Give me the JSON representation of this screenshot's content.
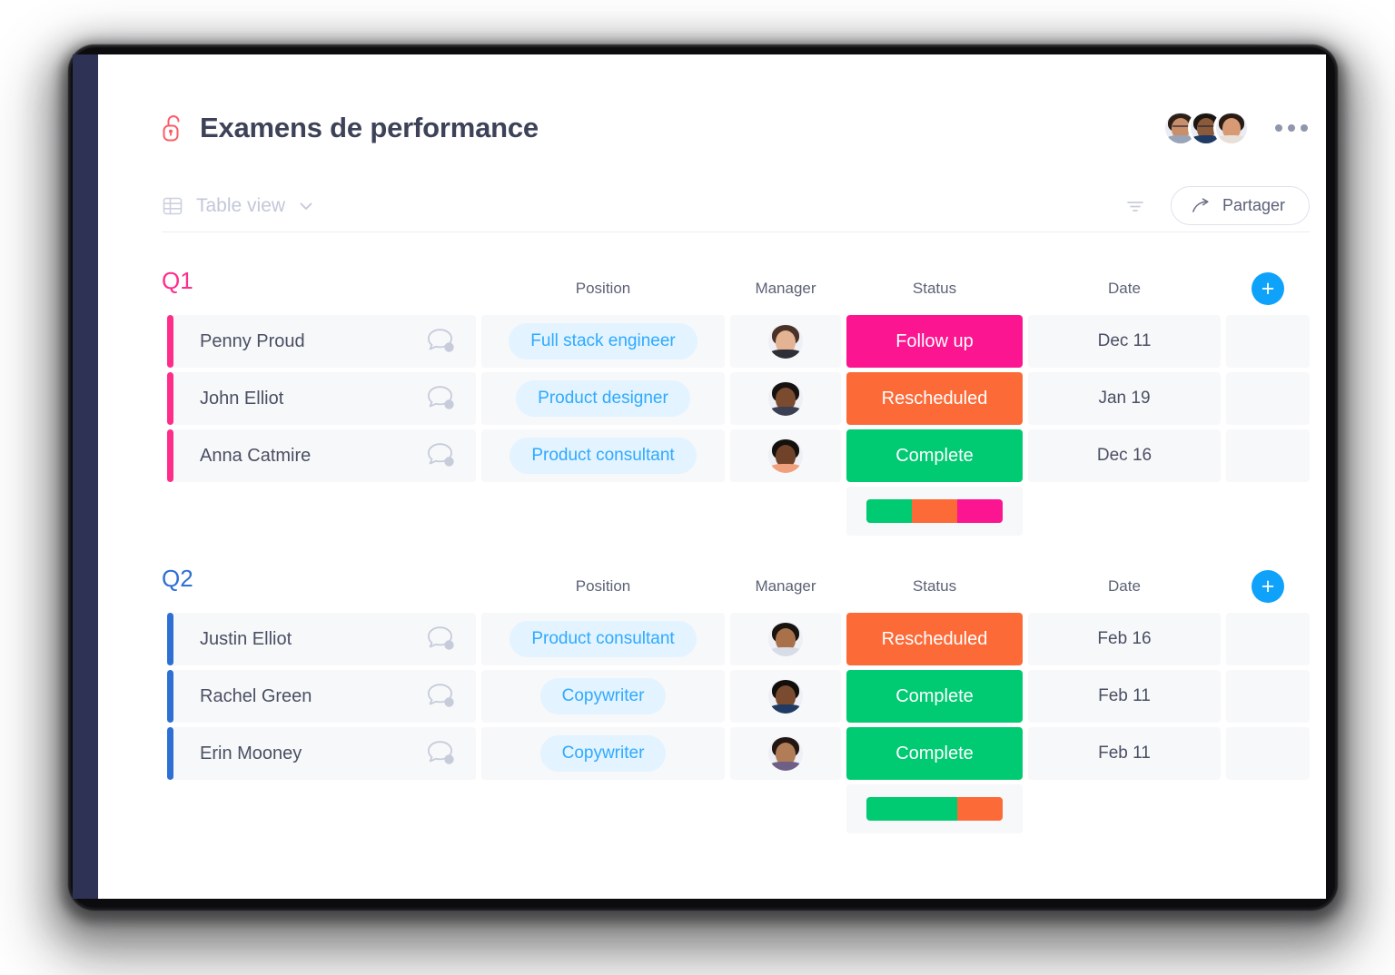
{
  "header": {
    "title": "Examens de performance",
    "lock_icon": "open-padlock-icon",
    "kebab_label": "More options",
    "avatars": [
      {
        "name": "member-1",
        "hair": "#2e2018",
        "skin": "#c98f6b",
        "body": "#9aa4b8"
      },
      {
        "name": "member-2",
        "hair": "#1b1510",
        "skin": "#8a5a3b",
        "body": "#1f3a63"
      },
      {
        "name": "member-3",
        "hair": "#2a1c14",
        "skin": "#d89a74",
        "body": "#e8e0d8"
      }
    ]
  },
  "viewbar": {
    "table_icon": "table-icon",
    "view_label": "Table view",
    "chevron_icon": "chevron-down-icon",
    "filter_icon": "filter-icon",
    "share_icon": "share-arrow-icon",
    "share_label": "Partager"
  },
  "columns": [
    "",
    "Position",
    "Manager",
    "Status",
    "Date",
    ""
  ],
  "add_button_label": "+",
  "groups": [
    {
      "id": "q1",
      "title": "Q1",
      "accent": "#ff2d8a",
      "rows": [
        {
          "name": "Penny Proud",
          "position": "Full stack engineer",
          "status": "Follow up",
          "status_color": "#fc1590",
          "date": "Dec 11",
          "manager": {
            "name": "manager-penny",
            "hair": "#4a3228",
            "skin": "#e3b394",
            "body": "#2f2f38"
          }
        },
        {
          "name": "John Elliot",
          "position": "Product designer",
          "status": "Rescheduled",
          "status_color": "#fb6a37",
          "date": "Jan 19",
          "manager": {
            "name": "manager-john",
            "hair": "#171210",
            "skin": "#7b4b30",
            "body": "#3a3f52"
          }
        },
        {
          "name": "Anna Catmire",
          "position": "Product consultant",
          "status": "Complete",
          "status_color": "#00ca72",
          "date": "Dec 16",
          "manager": {
            "name": "manager-anna",
            "hair": "#14100d",
            "skin": "#6f4229",
            "body": "#f0a07c"
          }
        }
      ],
      "summary": [
        {
          "color": "#00ca72",
          "percent": 33.34
        },
        {
          "color": "#fb6a37",
          "percent": 33.33
        },
        {
          "color": "#fc1590",
          "percent": 33.33
        }
      ]
    },
    {
      "id": "q2",
      "title": "Q2",
      "accent": "#2e6fd4",
      "rows": [
        {
          "name": "Justin Elliot",
          "position": "Product consultant",
          "status": "Rescheduled",
          "status_color": "#fb6a37",
          "date": "Feb 16",
          "manager": {
            "name": "manager-justin",
            "hair": "#1a1411",
            "skin": "#a9714a",
            "body": "#d8dce6"
          }
        },
        {
          "name": "Rachel Green",
          "position": "Copywriter",
          "status": "Complete",
          "status_color": "#00ca72",
          "date": "Feb 11",
          "manager": {
            "name": "manager-rachel",
            "hair": "#120e0c",
            "skin": "#7a4b2e",
            "body": "#1f3b63"
          }
        },
        {
          "name": "Erin Mooney",
          "position": "Copywriter",
          "status": "Complete",
          "status_color": "#00ca72",
          "date": "Feb 11",
          "manager": {
            "name": "manager-erin",
            "hair": "#221713",
            "skin": "#b07d57",
            "body": "#6d5f86"
          }
        }
      ],
      "summary": [
        {
          "color": "#00ca72",
          "percent": 66.7
        },
        {
          "color": "#fb6a37",
          "percent": 33.3
        }
      ]
    }
  ],
  "icons": {
    "chat_icon": "chat-bubble-icon"
  }
}
